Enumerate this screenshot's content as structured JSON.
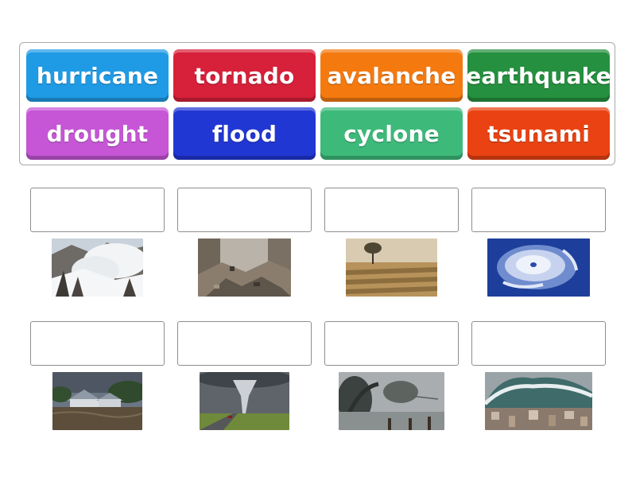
{
  "word_bank": {
    "tiles": [
      {
        "label": "hurricane",
        "color": "#1f9be6"
      },
      {
        "label": "tornado",
        "color": "#d7203a"
      },
      {
        "label": "avalanche",
        "color": "#f47a10"
      },
      {
        "label": "earthquake",
        "color": "#25903f"
      },
      {
        "label": "drought",
        "color": "#c656d6"
      },
      {
        "label": "flood",
        "color": "#2137d4"
      },
      {
        "label": "cyclone",
        "color": "#3dba7a"
      },
      {
        "label": "tsunami",
        "color": "#ea4212"
      }
    ]
  },
  "drop_boxes": [
    {
      "value": ""
    },
    {
      "value": ""
    },
    {
      "value": ""
    },
    {
      "value": ""
    },
    {
      "value": ""
    },
    {
      "value": ""
    },
    {
      "value": ""
    },
    {
      "value": ""
    }
  ],
  "images": [
    {
      "depicts": "avalanche"
    },
    {
      "depicts": "earthquake"
    },
    {
      "depicts": "drought"
    },
    {
      "depicts": "hurricane"
    },
    {
      "depicts": "flood"
    },
    {
      "depicts": "tornado"
    },
    {
      "depicts": "cyclone"
    },
    {
      "depicts": "tsunami"
    }
  ]
}
